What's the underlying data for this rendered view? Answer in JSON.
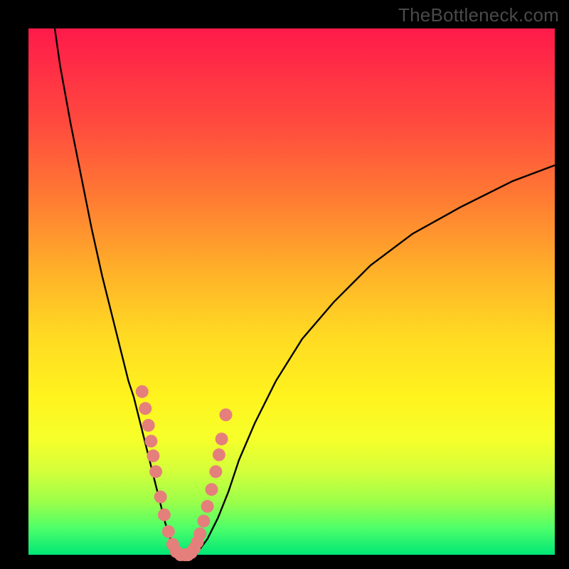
{
  "watermark": "TheBottleneck.com",
  "colors": {
    "background_frame": "#000000",
    "curve_stroke": "#000000",
    "marker_fill": "#e57f7c",
    "marker_stroke": "#c86a67"
  },
  "chart_data": {
    "type": "line",
    "title": "",
    "xlabel": "",
    "ylabel": "",
    "xlim": [
      0,
      100
    ],
    "ylim": [
      0,
      100
    ],
    "grid": false,
    "legend": false,
    "series": [
      {
        "name": "bottleneck-curve",
        "x": [
          5,
          6,
          8,
          10,
          12,
          14,
          16,
          18,
          19,
          20,
          21,
          22,
          23,
          24,
          25,
          26,
          27,
          28,
          29,
          30,
          31,
          32.5,
          34,
          36,
          38,
          40,
          43,
          47,
          52,
          58,
          65,
          73,
          82,
          92,
          100
        ],
        "y": [
          100,
          93,
          82,
          72,
          62,
          53,
          45,
          37,
          33,
          30,
          26,
          22,
          18,
          14,
          10,
          6,
          3,
          1,
          0,
          0,
          0,
          1,
          3,
          7,
          12,
          18,
          25,
          33,
          41,
          48,
          55,
          61,
          66,
          71,
          74
        ]
      }
    ],
    "markers": {
      "name": "highlighted-points",
      "x": [
        21.6,
        22.2,
        22.8,
        23.3,
        23.7,
        24.2,
        25.1,
        25.8,
        26.6,
        27.4,
        28.1,
        28.9,
        29.7,
        30.3,
        30.9,
        31.5,
        32.1,
        32.6,
        33.3,
        34.0,
        34.8,
        35.6,
        36.2,
        36.7,
        37.5
      ],
      "y": [
        31.0,
        27.8,
        24.6,
        21.6,
        18.8,
        15.8,
        11.0,
        7.6,
        4.4,
        2.0,
        0.6,
        0.0,
        0.0,
        0.0,
        0.4,
        1.2,
        2.4,
        4.0,
        6.4,
        9.2,
        12.4,
        15.8,
        19.0,
        22.0,
        26.6
      ]
    }
  }
}
